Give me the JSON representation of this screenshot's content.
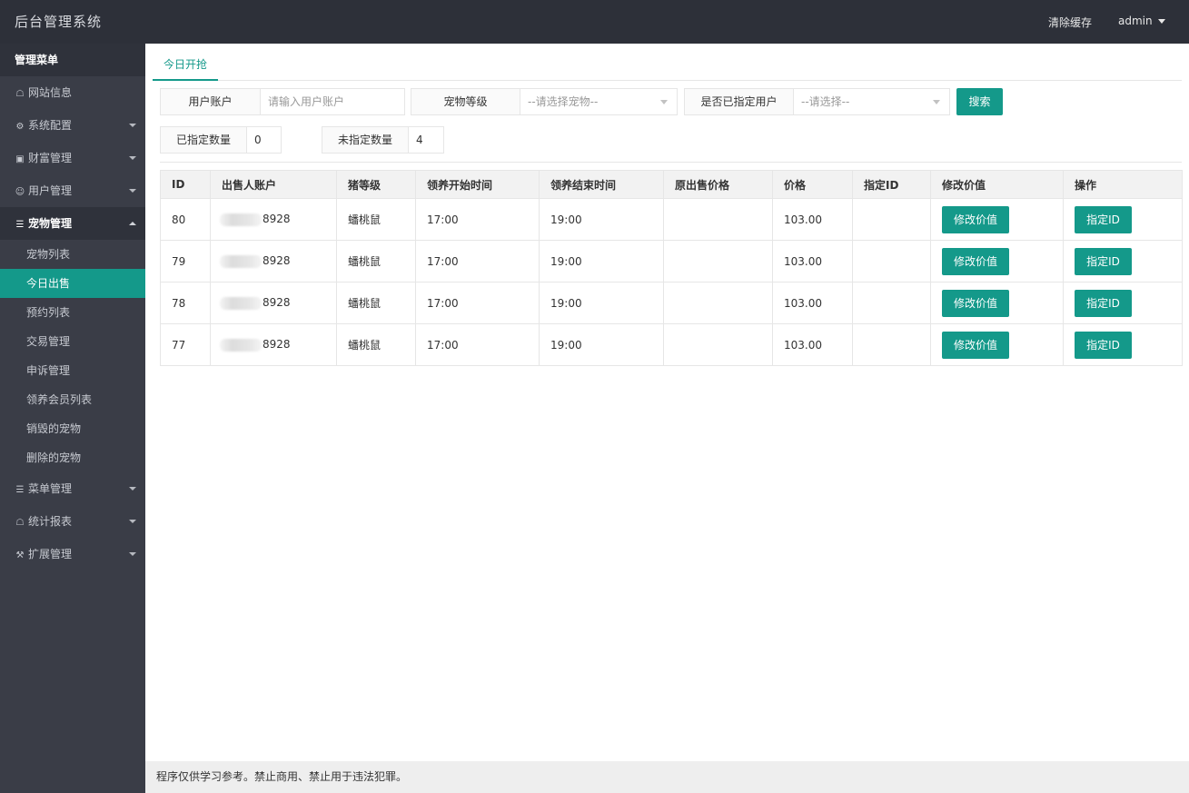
{
  "header": {
    "title": "后台管理系统",
    "clear_cache": "清除缓存",
    "user": "admin"
  },
  "sidebar": {
    "menu_title": "管理菜单",
    "items": [
      {
        "label": "网站信息",
        "icon": "home-icon"
      },
      {
        "label": "系统配置",
        "icon": "gears-icon"
      },
      {
        "label": "财富管理",
        "icon": "money-icon"
      },
      {
        "label": "用户管理",
        "icon": "users-icon"
      },
      {
        "label": "宠物管理",
        "icon": "list-icon"
      },
      {
        "label": "菜单管理",
        "icon": "list-icon"
      },
      {
        "label": "统计报表",
        "icon": "home-icon"
      },
      {
        "label": "扩展管理",
        "icon": "wrench-icon"
      }
    ],
    "sub_items": [
      "宠物列表",
      "今日出售",
      "预约列表",
      "交易管理",
      "申诉管理",
      "领养会员列表",
      "销毁的宠物",
      "删除的宠物"
    ]
  },
  "tabs": {
    "active": "今日开抢"
  },
  "filters": {
    "account_label": "用户账户",
    "account_placeholder": "请输入用户账户",
    "pet_level_label": "宠物等级",
    "pet_level_value": "--请选择宠物--",
    "assigned_label": "是否已指定用户",
    "assigned_value": "--请选择--",
    "search_button": "搜索"
  },
  "counts": {
    "assigned_label": "已指定数量",
    "assigned_value": "0",
    "unassigned_label": "未指定数量",
    "unassigned_value": "4"
  },
  "table": {
    "headers": [
      "ID",
      "出售人账户",
      "猪等级",
      "领养开始时间",
      "领养结束时间",
      "原出售价格",
      "价格",
      "指定ID",
      "修改价值",
      "操作"
    ],
    "rows": [
      {
        "id": "80",
        "account_suffix": "8928",
        "level": "蟠桃鼠",
        "start": "17:00",
        "end": "19:00",
        "orig_price": "",
        "price": "103.00",
        "assigned_id": "",
        "edit_btn": "修改价值",
        "assign_btn": "指定ID"
      },
      {
        "id": "79",
        "account_suffix": "8928",
        "level": "蟠桃鼠",
        "start": "17:00",
        "end": "19:00",
        "orig_price": "",
        "price": "103.00",
        "assigned_id": "",
        "edit_btn": "修改价值",
        "assign_btn": "指定ID"
      },
      {
        "id": "78",
        "account_suffix": "8928",
        "level": "蟠桃鼠",
        "start": "17:00",
        "end": "19:00",
        "orig_price": "",
        "price": "103.00",
        "assigned_id": "",
        "edit_btn": "修改价值",
        "assign_btn": "指定ID"
      },
      {
        "id": "77",
        "account_suffix": "8928",
        "level": "蟠桃鼠",
        "start": "17:00",
        "end": "19:00",
        "orig_price": "",
        "price": "103.00",
        "assigned_id": "",
        "edit_btn": "修改价值",
        "assign_btn": "指定ID"
      }
    ]
  },
  "footer": {
    "text": "程序仅供学习参考。禁止商用、禁止用于违法犯罪。"
  },
  "colors": {
    "accent": "#14998a",
    "topbar": "#2d3039",
    "sidebar": "#3a3d47"
  }
}
